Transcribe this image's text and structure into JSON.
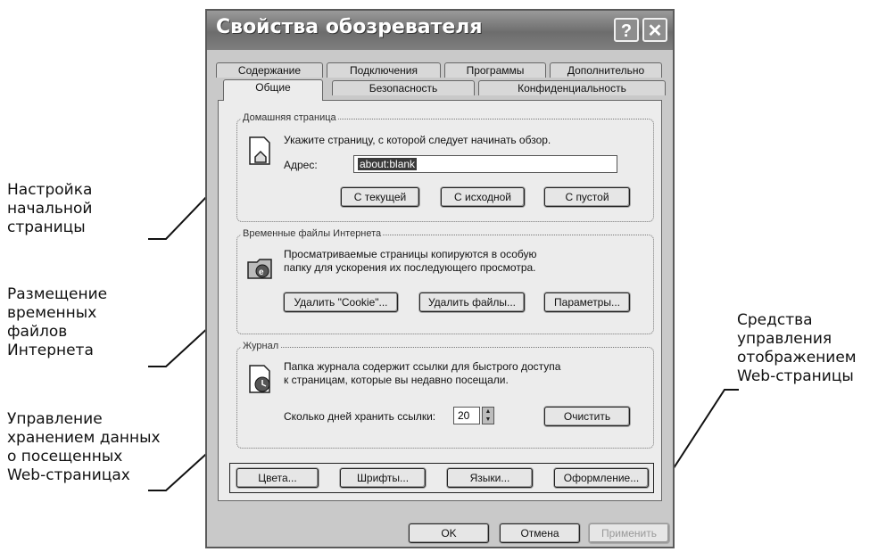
{
  "callouts": {
    "home": "Настройка\nначальной\nстраницы",
    "temp": "Размещение\nвременных\nфайлов\nИнтернета",
    "history": "Управление\nхранением данных\nо посещенных\nWeb-страницах",
    "display": "Средства\nуправления\nотображением\nWeb-страницы"
  },
  "dialog": {
    "title": "Свойства обозревателя",
    "help_glyph": "?",
    "close_glyph": "✕",
    "tabs_top": [
      "Содержание",
      "Подключения",
      "Программы",
      "Дополнительно"
    ],
    "tabs_bottom": [
      "Общие",
      "Безопасность",
      "Конфиденциальность"
    ],
    "active_tab": "Общие"
  },
  "home_page": {
    "label": "Домашняя страница",
    "instruction": "Укажите страницу, с которой следует начинать обзор.",
    "address_label": "Адрес:",
    "address_value": "about:blank",
    "btn_current": "С текущей",
    "btn_default": "С исходной",
    "btn_blank": "С пустой"
  },
  "temp_files": {
    "label": "Временные файлы Интернета",
    "line1": "Просматриваемые страницы копируются в особую",
    "line2": "папку для ускорения их последующего просмотра.",
    "btn_cookies": "Удалить \"Cookie\"...",
    "btn_files": "Удалить файлы...",
    "btn_settings": "Параметры..."
  },
  "history": {
    "label": "Журнал",
    "line1": "Папка журнала содержит ссылки для быстрого доступа",
    "line2": "к страницам, которые вы недавно посещали.",
    "days_label": "Сколько дней хранить ссылки:",
    "days_value": "20",
    "btn_clear": "Очистить"
  },
  "display_buttons": {
    "colors": "Цвета...",
    "fonts": "Шрифты...",
    "languages": "Языки...",
    "accessibility": "Оформление..."
  },
  "footer": {
    "ok": "OK",
    "cancel": "Отмена",
    "apply": "Применить"
  }
}
